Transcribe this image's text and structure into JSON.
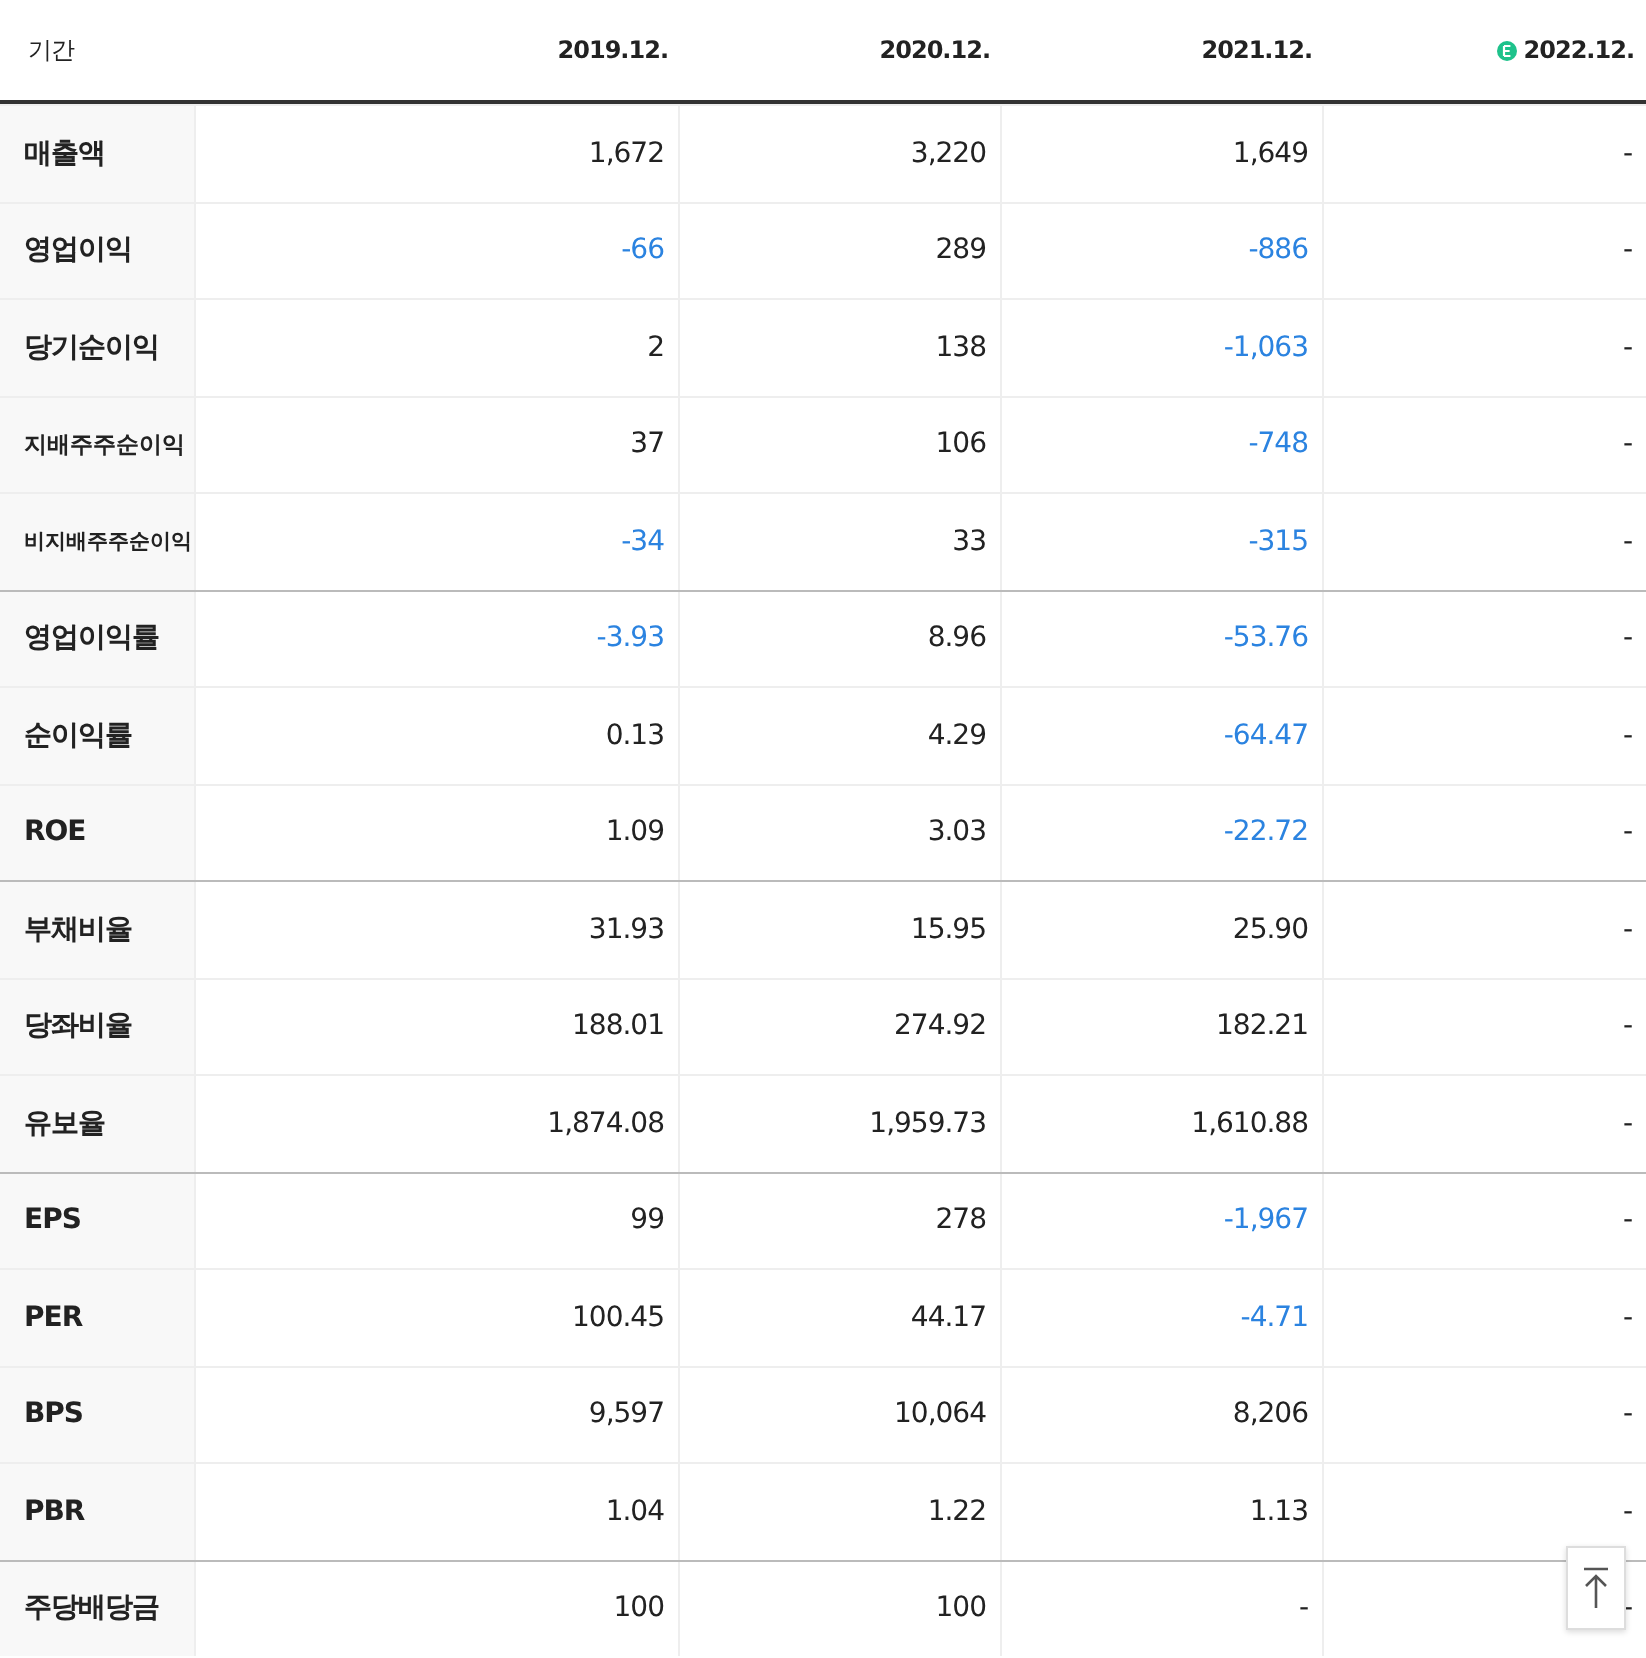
{
  "table": {
    "corner_label": "기간",
    "columns": [
      {
        "label": "2019.12.",
        "estimate": false
      },
      {
        "label": "2020.12.",
        "estimate": false
      },
      {
        "label": "2021.12.",
        "estimate": false
      },
      {
        "label": "2022.12.",
        "estimate": true
      }
    ],
    "rows": [
      {
        "label": "매출액",
        "group_start": false,
        "cells": [
          {
            "text": "1,672",
            "negative": false
          },
          {
            "text": "3,220",
            "negative": false
          },
          {
            "text": "1,649",
            "negative": false
          },
          {
            "text": "-",
            "negative": false
          }
        ]
      },
      {
        "label": "영업이익",
        "group_start": false,
        "cells": [
          {
            "text": "-66",
            "negative": true
          },
          {
            "text": "289",
            "negative": false
          },
          {
            "text": "-886",
            "negative": true
          },
          {
            "text": "-",
            "negative": false
          }
        ]
      },
      {
        "label": "당기순이익",
        "group_start": false,
        "cells": [
          {
            "text": "2",
            "negative": false
          },
          {
            "text": "138",
            "negative": false
          },
          {
            "text": "-1,063",
            "negative": true
          },
          {
            "text": "-",
            "negative": false
          }
        ]
      },
      {
        "label": "지배주주순이익",
        "group_start": false,
        "cells": [
          {
            "text": "37",
            "negative": false
          },
          {
            "text": "106",
            "negative": false
          },
          {
            "text": "-748",
            "negative": true
          },
          {
            "text": "-",
            "negative": false
          }
        ]
      },
      {
        "label": "비지배주주순이익",
        "group_start": false,
        "cells": [
          {
            "text": "-34",
            "negative": true
          },
          {
            "text": "33",
            "negative": false
          },
          {
            "text": "-315",
            "negative": true
          },
          {
            "text": "-",
            "negative": false
          }
        ]
      },
      {
        "label": "영업이익률",
        "group_start": true,
        "cells": [
          {
            "text": "-3.93",
            "negative": true
          },
          {
            "text": "8.96",
            "negative": false
          },
          {
            "text": "-53.76",
            "negative": true
          },
          {
            "text": "-",
            "negative": false
          }
        ]
      },
      {
        "label": "순이익률",
        "group_start": false,
        "cells": [
          {
            "text": "0.13",
            "negative": false
          },
          {
            "text": "4.29",
            "negative": false
          },
          {
            "text": "-64.47",
            "negative": true
          },
          {
            "text": "-",
            "negative": false
          }
        ]
      },
      {
        "label": "ROE",
        "group_start": false,
        "cells": [
          {
            "text": "1.09",
            "negative": false
          },
          {
            "text": "3.03",
            "negative": false
          },
          {
            "text": "-22.72",
            "negative": true
          },
          {
            "text": "-",
            "negative": false
          }
        ]
      },
      {
        "label": "부채비율",
        "group_start": true,
        "cells": [
          {
            "text": "31.93",
            "negative": false
          },
          {
            "text": "15.95",
            "negative": false
          },
          {
            "text": "25.90",
            "negative": false
          },
          {
            "text": "-",
            "negative": false
          }
        ]
      },
      {
        "label": "당좌비율",
        "group_start": false,
        "cells": [
          {
            "text": "188.01",
            "negative": false
          },
          {
            "text": "274.92",
            "negative": false
          },
          {
            "text": "182.21",
            "negative": false
          },
          {
            "text": "-",
            "negative": false
          }
        ]
      },
      {
        "label": "유보율",
        "group_start": false,
        "cells": [
          {
            "text": "1,874.08",
            "negative": false
          },
          {
            "text": "1,959.73",
            "negative": false
          },
          {
            "text": "1,610.88",
            "negative": false
          },
          {
            "text": "-",
            "negative": false
          }
        ]
      },
      {
        "label": "EPS",
        "group_start": true,
        "cells": [
          {
            "text": "99",
            "negative": false
          },
          {
            "text": "278",
            "negative": false
          },
          {
            "text": "-1,967",
            "negative": true
          },
          {
            "text": "-",
            "negative": false
          }
        ]
      },
      {
        "label": "PER",
        "group_start": false,
        "cells": [
          {
            "text": "100.45",
            "negative": false
          },
          {
            "text": "44.17",
            "negative": false
          },
          {
            "text": "-4.71",
            "negative": true
          },
          {
            "text": "-",
            "negative": false
          }
        ]
      },
      {
        "label": "BPS",
        "group_start": false,
        "cells": [
          {
            "text": "9,597",
            "negative": false
          },
          {
            "text": "10,064",
            "negative": false
          },
          {
            "text": "8,206",
            "negative": false
          },
          {
            "text": "-",
            "negative": false
          }
        ]
      },
      {
        "label": "PBR",
        "group_start": false,
        "cells": [
          {
            "text": "1.04",
            "negative": false
          },
          {
            "text": "1.22",
            "negative": false
          },
          {
            "text": "1.13",
            "negative": false
          },
          {
            "text": "-",
            "negative": false
          }
        ]
      },
      {
        "label": "주당배당금",
        "group_start": true,
        "cells": [
          {
            "text": "100",
            "negative": false
          },
          {
            "text": "100",
            "negative": false
          },
          {
            "text": "-",
            "negative": false
          },
          {
            "text": "-",
            "negative": false
          }
        ]
      }
    ]
  }
}
